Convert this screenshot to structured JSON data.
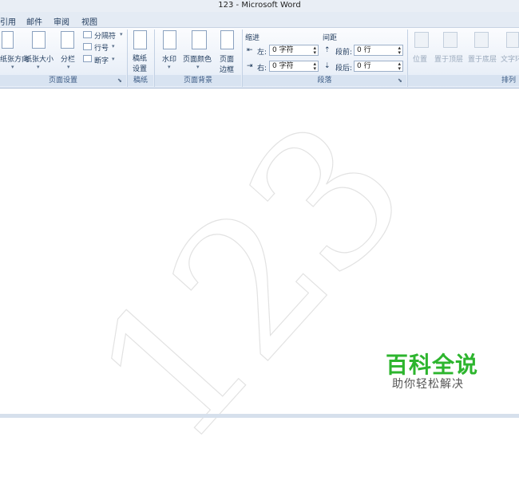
{
  "window": {
    "title": "123 - Microsoft Word"
  },
  "menu": {
    "items": [
      "引用",
      "邮件",
      "审阅",
      "视图"
    ]
  },
  "ribbon": {
    "page_setup": {
      "label": "页面设置",
      "orientation": "纸张方向",
      "size": "纸张大小",
      "columns": "分栏",
      "breaks": "分隔符",
      "line_numbers": "行号",
      "hyphenation": "断字"
    },
    "manuscript": {
      "label": "稿纸",
      "button": [
        "稿纸",
        "设置"
      ]
    },
    "page_background": {
      "label": "页面背景",
      "watermark": "水印",
      "page_color": "页面颜色",
      "page_border": [
        "页面",
        "边框"
      ]
    },
    "paragraph": {
      "label": "段落",
      "indent_title": "缩进",
      "spacing_title": "间距",
      "indent_left_label": "左:",
      "indent_left_value": "0 字符",
      "indent_right_label": "右:",
      "indent_right_value": "0 字符",
      "spacing_before_label": "段前:",
      "spacing_before_value": "0 行",
      "spacing_after_label": "段后:",
      "spacing_after_value": "0 行"
    },
    "arrange": {
      "label": "排列",
      "position": "位置",
      "bring_front": "置于顶层",
      "send_back": "置于底层",
      "text_wrap": "文字环"
    }
  },
  "document": {
    "watermark_text": "123"
  },
  "brand": {
    "title": "百科全说",
    "subtitle": "助你轻松解决"
  }
}
